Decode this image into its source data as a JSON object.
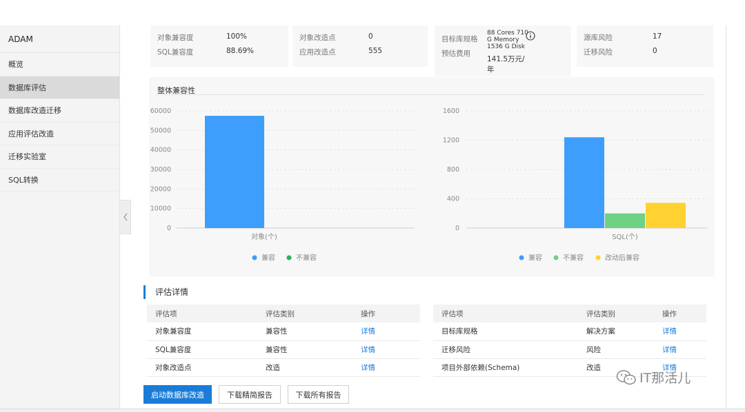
{
  "sidebar": {
    "title": "ADAM",
    "items": [
      {
        "label": "概览",
        "active": false
      },
      {
        "label": "数据库评估",
        "active": true
      },
      {
        "label": "数据库改造迁移",
        "active": false
      },
      {
        "label": "应用评估改造",
        "active": false
      },
      {
        "label": "迁移实验室",
        "active": false
      },
      {
        "label": "SQL转换",
        "active": false
      }
    ]
  },
  "summary": {
    "card1": {
      "obj_compat_label": "对象兼容度",
      "obj_compat_value": "100%",
      "sql_compat_label": "SQL兼容度",
      "sql_compat_value": "88.69%"
    },
    "card2": {
      "obj_change_label": "对象改造点",
      "obj_change_value": "0",
      "app_change_label": "应用改造点",
      "app_change_value": "555"
    },
    "card3": {
      "target_spec_label": "目标库规格",
      "target_spec_line1": "88 Cores 710",
      "target_spec_line2": "G Memory",
      "target_spec_line3": "1536 G Disk",
      "cost_label": "预估费用",
      "cost_line1": "141.5万元/",
      "cost_line2": "年"
    },
    "card4": {
      "source_risk_label": "源库风险",
      "source_risk_value": "17",
      "migration_risk_label": "迁移风险",
      "migration_risk_value": "0"
    }
  },
  "compat_panel": {
    "title": "整体兼容性"
  },
  "chart_data": [
    {
      "type": "bar",
      "categories": [
        "对象(个)"
      ],
      "series": [
        {
          "name": "兼容",
          "values": [
            57500
          ],
          "color": "#3d9efc"
        },
        {
          "name": "不兼容",
          "values": [
            0
          ],
          "color": "#27b35b"
        }
      ],
      "xlabel": "对象(个)",
      "ylim": [
        0,
        60000
      ],
      "yticks": [
        0,
        10000,
        20000,
        30000,
        40000,
        50000,
        60000
      ],
      "grid": true,
      "legend": "bottom"
    },
    {
      "type": "bar",
      "categories": [
        "SQL(个)"
      ],
      "series": [
        {
          "name": "兼容",
          "values": [
            1240
          ],
          "color": "#3d9efc"
        },
        {
          "name": "不兼容",
          "values": [
            200
          ],
          "color": "#6fd184"
        },
        {
          "name": "改动后兼容",
          "values": [
            345
          ],
          "color": "#ffd232"
        }
      ],
      "xlabel": "SQL(个)",
      "ylim": [
        0,
        1600
      ],
      "yticks": [
        0,
        400,
        800,
        1200,
        1600
      ],
      "grid": true,
      "legend": "bottom"
    }
  ],
  "details": {
    "title": "评估详情",
    "headers": [
      "评估项",
      "评估类别",
      "操作"
    ],
    "left_rows": [
      {
        "item": "对象兼容度",
        "category": "兼容性",
        "action": "详情"
      },
      {
        "item": "SQL兼容度",
        "category": "兼容性",
        "action": "详情"
      },
      {
        "item": "对象改造点",
        "category": "改造",
        "action": "详情"
      }
    ],
    "right_rows": [
      {
        "item": "目标库规格",
        "category": "解决方案",
        "action": "详情"
      },
      {
        "item": "迁移风险",
        "category": "风险",
        "action": "详情"
      },
      {
        "item": "项目外部依赖(Schema)",
        "category": "改造",
        "action": "详情"
      }
    ]
  },
  "buttons": {
    "start_migration": "启动数据库改造",
    "download_brief": "下载精简报告",
    "download_all": "下载所有报告"
  },
  "watermark": {
    "text": "IT那活儿",
    "icon": "wechat-icon"
  }
}
